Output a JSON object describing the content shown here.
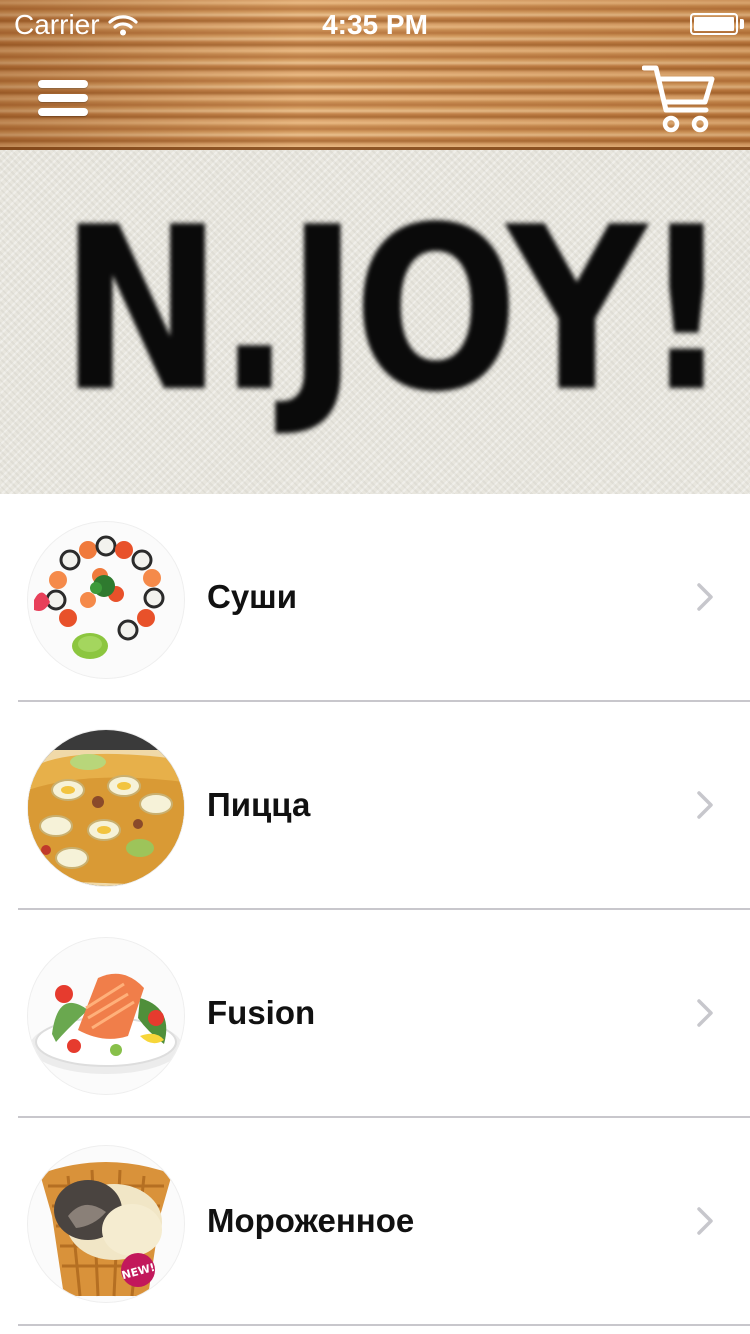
{
  "status_bar": {
    "carrier": "Carrier",
    "time": "4:35 PM",
    "wifi_icon": "wifi-icon",
    "battery_icon": "battery-icon"
  },
  "header": {
    "menu_icon": "hamburger-menu-icon",
    "cart_icon": "shopping-cart-icon",
    "wood_color": "#c98b4e"
  },
  "banner": {
    "logo_text": "N.JOY!"
  },
  "categories": [
    {
      "label": "Суши",
      "image": "sushi-platter-image"
    },
    {
      "label": "Пицца",
      "image": "pizza-image"
    },
    {
      "label": "Fusion",
      "image": "salmon-salad-image"
    },
    {
      "label": "Мороженное",
      "image": "ice-cream-cone-image"
    }
  ],
  "colors": {
    "separator": "#c8c7cc",
    "chevron": "#c7c7cc",
    "text": "#111111"
  }
}
